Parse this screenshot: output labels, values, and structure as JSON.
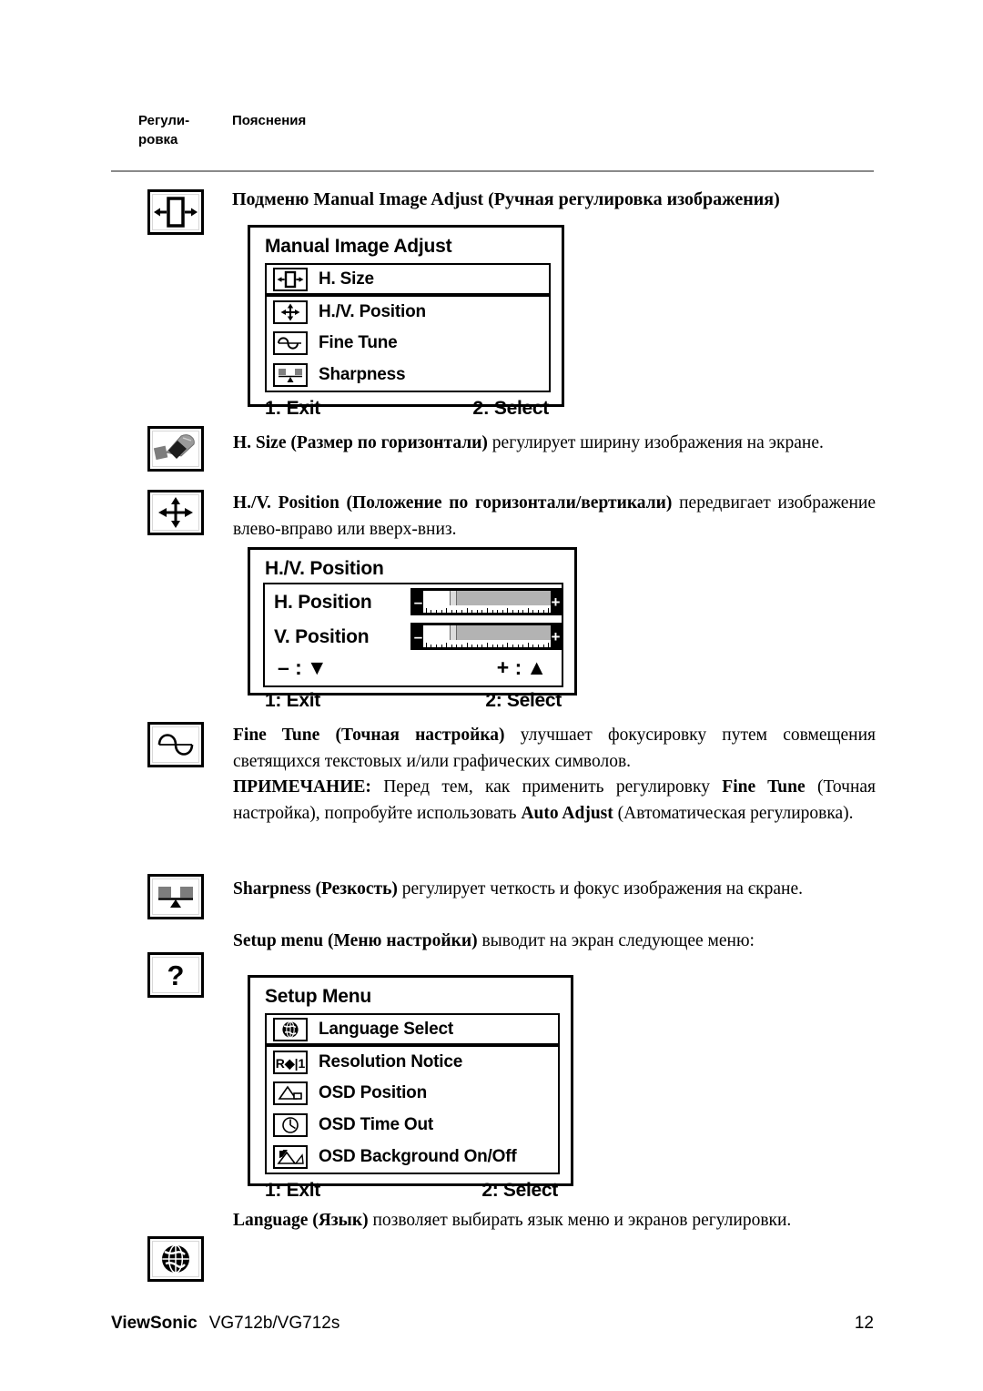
{
  "columns": {
    "left_header": "Регули-\nровка",
    "right_header": "Пояснения"
  },
  "sections": {
    "manual_image_adjust_heading": "Подменю Manual Image Adjust (Ручная регулировка изображения)",
    "h_size_text_bold": "H. Size (Размер по горизонтали)",
    "h_size_text_rest": " регулирует ширину изображения на экране.",
    "hv_position_text_bold": "H./V. Position (Положение по горизонтали/вертикали)",
    "hv_position_text_rest": " передвигает изображение влево-вправо или вверх-вниз.",
    "fine_tune_text_bold": "Fine Tune (Точная настройка)",
    "fine_tune_text_rest": " улучшает фокусировку путем совмещения светящихся текстовых и/или графических символов.",
    "note_label": "ПРИМЕЧАНИЕ:",
    "note_part1": " Перед тем, как применить регулировку ",
    "note_bold1": "Fine Tune",
    "note_part2": " (Точная настройка), попробуйте использовать ",
    "note_bold2": "Auto Adjust",
    "note_part3": " (Автоматическая регулировка).",
    "sharpness_text_bold": "Sharpness (Резкость)",
    "sharpness_text_rest": " регулирует четкость и фокус изображения на єкране.",
    "setup_menu_text_bold": "Setup menu (Меню настройки)",
    "setup_menu_text_rest": " выводит на экран следующее меню:",
    "language_text_bold": "Language (Язык)",
    "language_text_rest": " позволяет выбирать язык меню и экранов регулировки."
  },
  "osd_manual_image_adjust": {
    "title": "Manual Image Adjust",
    "items": [
      {
        "label": "H. Size",
        "icon": "h-size-icon",
        "selected": true
      },
      {
        "label": "H./V. Position",
        "icon": "four-arrows-icon",
        "selected": false
      },
      {
        "label": "Fine Tune",
        "icon": "sine-wave-icon",
        "selected": false
      },
      {
        "label": "Sharpness",
        "icon": "sharpness-icon",
        "selected": false
      }
    ],
    "exit_label": "1: Exit",
    "select_label": "2: Select"
  },
  "osd_hv_position": {
    "title": "H./V. Position",
    "sliders": [
      {
        "label": "H. Position",
        "minus": "–",
        "plus": "+",
        "value_percent": 22
      },
      {
        "label": "V. Position",
        "minus": "–",
        "plus": "+",
        "value_percent": 22
      }
    ],
    "minus_hint": "– :",
    "minus_arrow": "▼",
    "plus_hint": "+ :",
    "plus_arrow": "▲",
    "exit_label": "1: Exit",
    "select_label": "2: Select"
  },
  "osd_setup_menu": {
    "title": "Setup Menu",
    "items": [
      {
        "label": "Language Select",
        "icon": "globe-icon",
        "selected": true
      },
      {
        "label": "Resolution Notice",
        "icon": "resolution-notice-icon",
        "selected": false
      },
      {
        "label": "OSD Position",
        "icon": "osd-position-icon",
        "selected": false
      },
      {
        "label": "OSD Time Out",
        "icon": "clock-icon",
        "selected": false
      },
      {
        "label": "OSD Background On/Off",
        "icon": "osd-background-icon",
        "selected": false
      }
    ],
    "resolution_icon_text": "R◆|1",
    "exit_label": "1: Exit",
    "select_label": "2: Select"
  },
  "margin_icons": [
    {
      "name": "h-size-icon"
    },
    {
      "name": "contrast-hand-icon"
    },
    {
      "name": "four-arrows-icon"
    },
    {
      "name": "sine-wave-icon"
    },
    {
      "name": "sharpness-icon"
    },
    {
      "name": "question-mark-icon"
    },
    {
      "name": "globe-icon"
    }
  ],
  "footer": {
    "brand": "ViewSonic",
    "model": "VG712b/VG712s",
    "page_number": "12"
  }
}
